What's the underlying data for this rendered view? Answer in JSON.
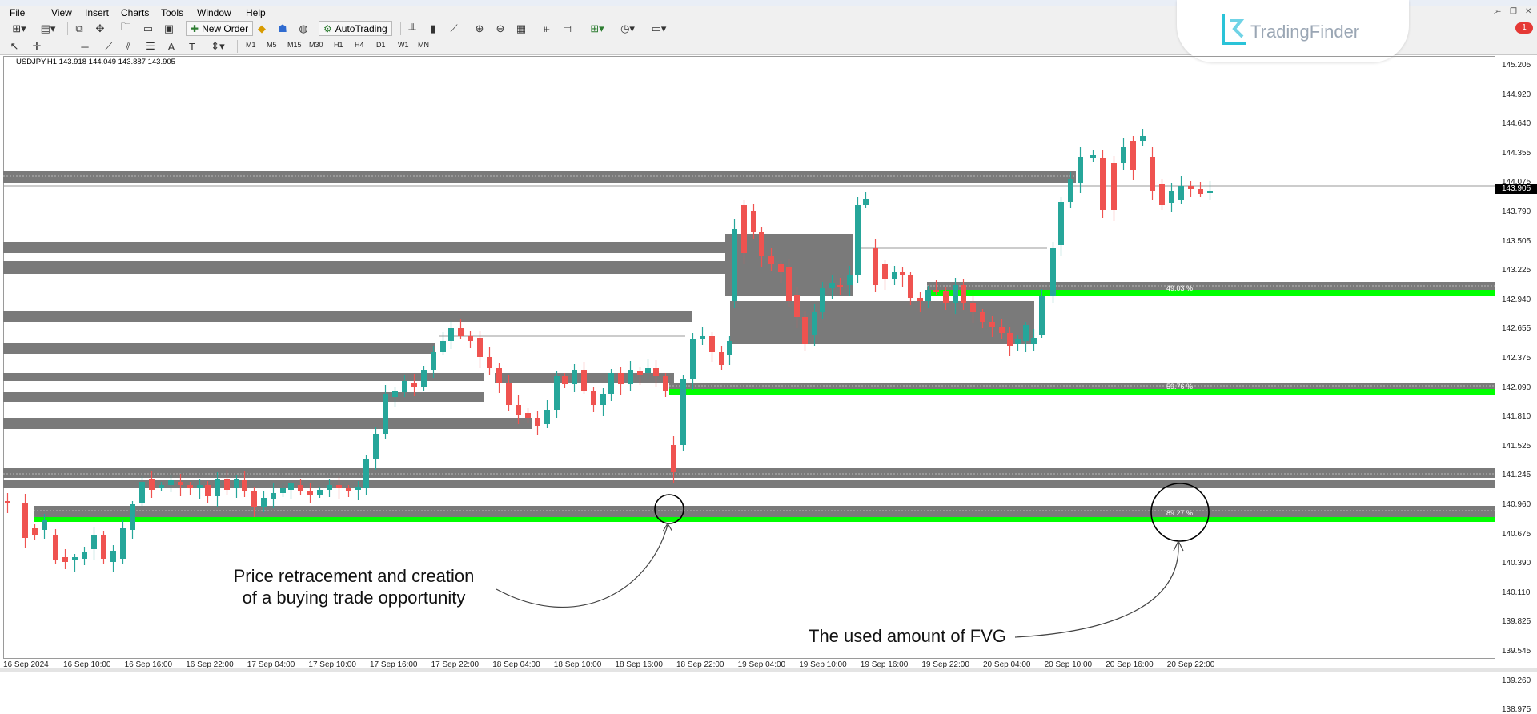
{
  "menu": [
    "File",
    "View",
    "Insert",
    "Charts",
    "Tools",
    "Window",
    "Help"
  ],
  "toolbar": {
    "new_order": "New Order",
    "autotrading": "AutoTrading",
    "timeframes": [
      "M1",
      "M5",
      "M15",
      "M30",
      "H1",
      "H4",
      "D1",
      "W1",
      "MN"
    ],
    "alert_badge": "1"
  },
  "logo": {
    "text": "TradingFinder"
  },
  "chart": {
    "symbol_line": "USDJPY,H1  143.918 144.049 143.887 143.905",
    "current_price": "143.905",
    "price_labels": [
      "145.205",
      "144.920",
      "144.640",
      "144.355",
      "144.075",
      "143.790",
      "143.505",
      "143.225",
      "142.940",
      "142.655",
      "142.375",
      "142.090",
      "141.810",
      "141.525",
      "141.245",
      "140.960",
      "140.675",
      "140.390",
      "140.110",
      "139.825",
      "139.545",
      "139.260",
      "138.975"
    ],
    "time_labels": [
      "16 Sep 2024",
      "16 Sep 10:00",
      "16 Sep 16:00",
      "16 Sep 22:00",
      "17 Sep 04:00",
      "17 Sep 10:00",
      "17 Sep 16:00",
      "17 Sep 22:00",
      "18 Sep 04:00",
      "18 Sep 10:00",
      "18 Sep 16:00",
      "18 Sep 22:00",
      "19 Sep 04:00",
      "19 Sep 10:00",
      "19 Sep 16:00",
      "19 Sep 22:00",
      "20 Sep 04:00",
      "20 Sep 10:00",
      "20 Sep 16:00",
      "20 Sep 22:00"
    ],
    "fvg_labels": [
      "49.03 %",
      "59.76 %",
      "89.27 %"
    ],
    "colors": {
      "bull": "#26a69a",
      "bear": "#ef5350",
      "zone": "#7a7a7a",
      "fill": "#00ff00"
    }
  },
  "annotations": {
    "left_line1": "Price retracement and creation",
    "left_line2": "of a buying trade opportunity",
    "right": "The used amount of FVG"
  }
}
